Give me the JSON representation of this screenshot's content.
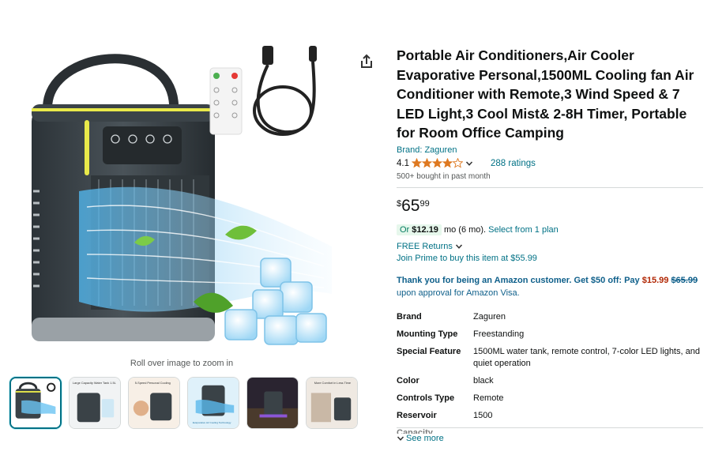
{
  "gallery": {
    "zoom_hint": "Roll over image to zoom in",
    "main_image_icon": "air-cooler-product-image",
    "remote_buttons": [
      "ON",
      "OFF"
    ],
    "thumbnails": [
      {
        "caption": ""
      },
      {
        "caption": "Large Capacity Water Tank 1.5L"
      },
      {
        "caption": "5-Speed Personal Cooling"
      },
      {
        "caption": "Evaporative Air Cooling Technology"
      },
      {
        "caption": ""
      },
      {
        "caption": "More Comfort in Less Time"
      }
    ],
    "share_icon": "share-icon"
  },
  "product": {
    "title": "Portable Air Conditioners,Air Cooler Evaporative Personal,1500ML Cooling fan Air Conditioner with Remote,3 Wind Speed & 7 LED Light,3 Cool Mist& 2-8H Timer, Portable for Room Office Camping",
    "brand": "Brand: Zaguren",
    "rating": "4.1",
    "stars_filled": 4.1,
    "ratings_count": "288 ratings",
    "bought": "500+ bought in past month"
  },
  "pricing": {
    "currency": "$",
    "whole": "65",
    "fraction": "99",
    "or_label": "Or ",
    "monthly_amount": "$12.19",
    "monthly_suffix": "mo (6 mo).",
    "plan_link": "Select from 1 plan",
    "returns": "FREE Returns",
    "prime": "Join Prime to buy this item at $55.99"
  },
  "promo": {
    "line1": "Thank you for being an Amazon customer. Get $50 off: Pay",
    "new_price": "$15.99",
    "old_price": "$65.99",
    "line2": "upon approval for Amazon Visa."
  },
  "specs": [
    {
      "key": "Brand",
      "value": "Zaguren"
    },
    {
      "key": "Mounting Type",
      "value": "Freestanding"
    },
    {
      "key": "Special Feature",
      "value": "1500ML water tank, remote control, 7-color LED lights, and quiet operation"
    },
    {
      "key": "Color",
      "value": "black"
    },
    {
      "key": "Controls Type",
      "value": "Remote"
    },
    {
      "key": "Reservoir",
      "value": "1500"
    },
    {
      "key": "Capacity",
      "value": ""
    }
  ],
  "see_more": "See more",
  "colors": {
    "link": "#007185",
    "price_red": "#b12704",
    "star": "#de7921",
    "green": "#067d62"
  }
}
